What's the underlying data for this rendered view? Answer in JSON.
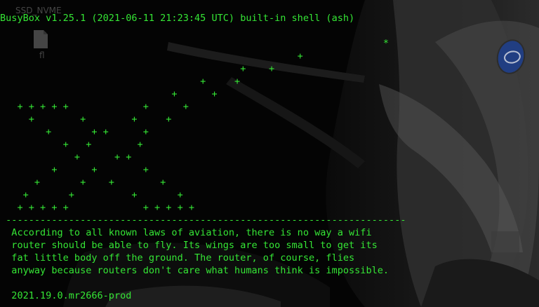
{
  "desktop": {
    "label": "SSD_NVME",
    "file_label": "fl"
  },
  "terminal": {
    "lines": [
      "BusyBox v1.25.1 (2021-06-11 21:23:45 UTC) built-in shell (ash)",
      "",
      "                                                                   *",
      "                                                    +",
      "                                          +    +",
      "                                   +     +",
      "                              +      +",
      "   + + + + +             +      +",
      "     +        +        +     +",
      "        +       + +      +",
      "           +   +        +",
      "             +      + +",
      "         +      +        +",
      "      +       +    +        +",
      "    +       +          +       +",
      "   + + + + +             + + + + +",
      " ----------------------------------------------------------------------",
      "  According to all known laws of aviation, there is no way a wifi",
      "  router should be able to fly. Its wings are too small to get its",
      "  fat little body off the ground. The router, of course, flies",
      "  anyway because routers don't care what humans think is impossible.",
      "",
      "  2021.19.0.mr2666-prod"
    ]
  }
}
